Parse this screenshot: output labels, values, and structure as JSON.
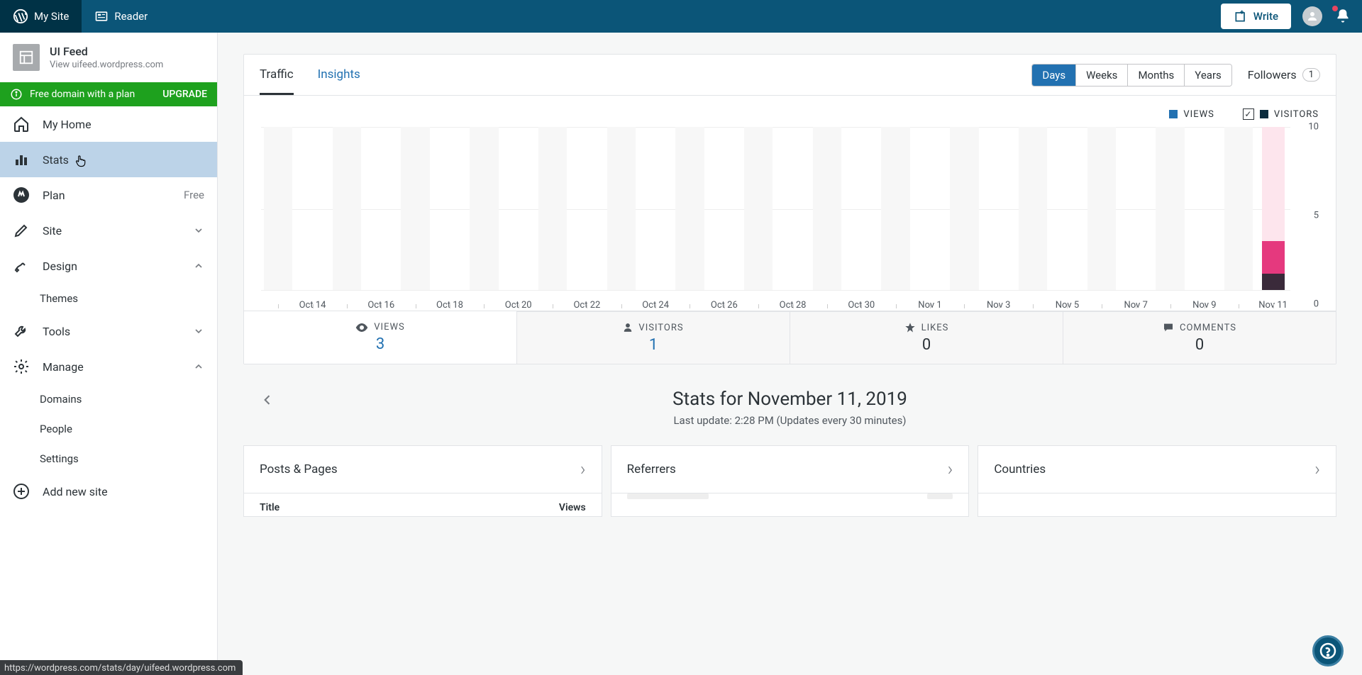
{
  "topbar": {
    "mysite": "My Site",
    "reader": "Reader",
    "write": "Write"
  },
  "site": {
    "name": "UI Feed",
    "url_prefix": "View ",
    "url": "uifeed.wordpress.com"
  },
  "upgrade": {
    "text": "Free domain with a plan",
    "button": "UPGRADE"
  },
  "nav": {
    "home": "My Home",
    "stats": "Stats",
    "plan": "Plan",
    "plan_badge": "Free",
    "site": "Site",
    "design": "Design",
    "themes": "Themes",
    "tools": "Tools",
    "manage": "Manage",
    "domains": "Domains",
    "people": "People",
    "settings": "Settings",
    "addsite": "Add new site"
  },
  "tabs": {
    "traffic": "Traffic",
    "insights": "Insights"
  },
  "periods": {
    "days": "Days",
    "weeks": "Weeks",
    "months": "Months",
    "years": "Years"
  },
  "followers": {
    "label": "Followers",
    "count": "1"
  },
  "legend": {
    "views": "VIEWS",
    "visitors": "VISITORS"
  },
  "yaxis": {
    "top": "10",
    "mid": "5",
    "bottom": "0"
  },
  "summary": {
    "views_label": "VIEWS",
    "views_value": "3",
    "visitors_label": "VISITORS",
    "visitors_value": "1",
    "likes_label": "LIKES",
    "likes_value": "0",
    "comments_label": "COMMENTS",
    "comments_value": "0"
  },
  "date_header": {
    "title": "Stats for November 11, 2019",
    "subtitle": "Last update: 2:28 PM (Updates every 30 minutes)"
  },
  "cards": {
    "posts": "Posts & Pages",
    "posts_col1": "Title",
    "posts_col2": "Views",
    "referrers": "Referrers",
    "countries": "Countries"
  },
  "status_url": "https://wordpress.com/stats/day/uifeed.wordpress.com",
  "chart_data": {
    "type": "bar",
    "categories": [
      "Oct 13",
      "Oct 14",
      "Oct 15",
      "Oct 16",
      "Oct 17",
      "Oct 18",
      "Oct 19",
      "Oct 20",
      "Oct 21",
      "Oct 22",
      "Oct 23",
      "Oct 24",
      "Oct 25",
      "Oct 26",
      "Oct 27",
      "Oct 28",
      "Oct 29",
      "Oct 30",
      "Oct 31",
      "Nov 1",
      "Nov 2",
      "Nov 3",
      "Nov 4",
      "Nov 5",
      "Nov 6",
      "Nov 7",
      "Nov 8",
      "Nov 9",
      "Nov 10",
      "Nov 11"
    ],
    "x_tick_labels": [
      "Oct 14",
      "Oct 16",
      "Oct 18",
      "Oct 20",
      "Oct 22",
      "Oct 24",
      "Oct 26",
      "Oct 28",
      "Oct 30",
      "Nov 1",
      "Nov 3",
      "Nov 5",
      "Nov 7",
      "Nov 9",
      "Nov 11"
    ],
    "series": [
      {
        "name": "VIEWS",
        "values": [
          0,
          0,
          0,
          0,
          0,
          0,
          0,
          0,
          0,
          0,
          0,
          0,
          0,
          0,
          0,
          0,
          0,
          0,
          0,
          0,
          0,
          0,
          0,
          0,
          0,
          0,
          0,
          0,
          0,
          3
        ]
      },
      {
        "name": "VISITORS",
        "values": [
          0,
          0,
          0,
          0,
          0,
          0,
          0,
          0,
          0,
          0,
          0,
          0,
          0,
          0,
          0,
          0,
          0,
          0,
          0,
          0,
          0,
          0,
          0,
          0,
          0,
          0,
          0,
          0,
          0,
          1
        ]
      }
    ],
    "ylim": [
      0,
      10
    ],
    "selected_index": 29,
    "colors": {
      "views": "#e5397e",
      "views_ghost": "#fde5ed",
      "visitors": "#3a2a3a",
      "views_swatch": "#2271b1",
      "visitors_swatch": "#0b2c3d"
    }
  }
}
